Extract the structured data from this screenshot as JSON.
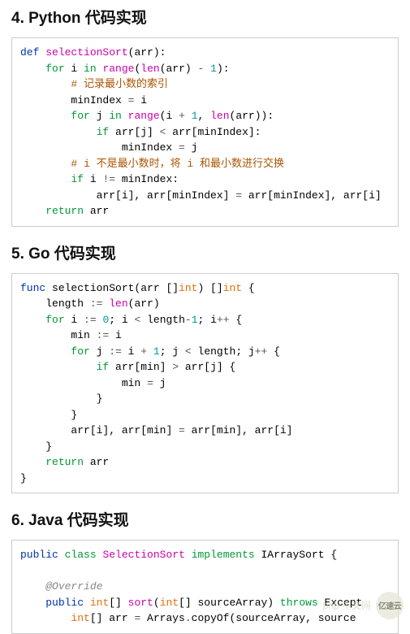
{
  "sections": {
    "python": {
      "heading": "4. Python 代码实现",
      "code": {
        "l1": {
          "kw": "def ",
          "fn": "selectionSort",
          "rest": "(arr):"
        },
        "l2": {
          "pre": "    ",
          "kw": "for",
          "rest1": " i ",
          "kw2": "in",
          "rest2": " ",
          "fn": "range",
          "rest3": "(",
          "fn2": "len",
          "rest4": "(arr) ",
          "op": "-",
          "rest5": " ",
          "num": "1",
          "rest6": "):"
        },
        "l3": {
          "pre": "        ",
          "c": "# 记录最小数的索引"
        },
        "l4": {
          "pre": "        ",
          "rest1": "minIndex ",
          "op": "=",
          "rest2": " i"
        },
        "l5": {
          "pre": "        ",
          "kw": "for",
          "rest1": " j ",
          "kw2": "in",
          "rest2": " ",
          "fn": "range",
          "rest3": "(i ",
          "op": "+",
          "rest4": " ",
          "num": "1",
          "rest5": ", ",
          "fn2": "len",
          "rest6": "(arr)):"
        },
        "l6": {
          "pre": "            ",
          "kw": "if",
          "rest1": " arr[j] ",
          "op": "<",
          "rest2": " arr[minIndex]:"
        },
        "l7": {
          "pre": "                ",
          "rest1": "minIndex ",
          "op": "=",
          "rest2": " j"
        },
        "l8": {
          "pre": "        ",
          "c": "# i 不是最小数时，将 i 和最小数进行交换"
        },
        "l9": {
          "pre": "        ",
          "kw": "if",
          "rest1": " i ",
          "op": "!=",
          "rest2": " minIndex:"
        },
        "l10": {
          "pre": "            ",
          "rest1": "arr[i], arr[minIndex] ",
          "op": "=",
          "rest2": " arr[minIndex], arr[i]"
        },
        "l11": {
          "pre": "    ",
          "kw": "return",
          "rest": " arr"
        }
      }
    },
    "go": {
      "heading": "5. Go 代码实现",
      "code": {
        "l1": {
          "kw": "func",
          "rest1": " selectionSort(arr []",
          "tp": "int",
          "rest2": ") []",
          "tp2": "int",
          "rest3": " {"
        },
        "l2": {
          "pre": "    ",
          "rest1": "length ",
          "op": ":=",
          "rest2": " ",
          "fn": "len",
          "rest3": "(arr)"
        },
        "l3": {
          "pre": "    ",
          "kw": "for",
          "rest1": " i ",
          "op": ":=",
          "rest2": " ",
          "num": "0",
          "rest3": "; i ",
          "op2": "<",
          "rest4": " length",
          "op3": "-",
          "num2": "1",
          "rest5": "; i",
          "op4": "++",
          "rest6": " {"
        },
        "l4": {
          "pre": "        ",
          "rest1": "min ",
          "op": ":=",
          "rest2": " i"
        },
        "l5": {
          "pre": "        ",
          "kw": "for",
          "rest1": " j ",
          "op": ":=",
          "rest2": " i ",
          "op2": "+",
          "rest3": " ",
          "num": "1",
          "rest4": "; j ",
          "op3": "<",
          "rest5": " length; j",
          "op4": "++",
          "rest6": " {"
        },
        "l6": {
          "pre": "            ",
          "kw": "if",
          "rest1": " arr[min] ",
          "op": ">",
          "rest2": " arr[j] {"
        },
        "l7": {
          "pre": "                ",
          "rest1": "min ",
          "op": "=",
          "rest2": " j"
        },
        "l8": {
          "pre": "            ",
          "rest": "}"
        },
        "l9": {
          "pre": "        ",
          "rest": "}"
        },
        "l10": {
          "pre": "        ",
          "rest1": "arr[i], arr[min] ",
          "op": "=",
          "rest2": " arr[min], arr[i]"
        },
        "l11": {
          "pre": "    ",
          "rest": "}"
        },
        "l12": {
          "pre": "    ",
          "kw": "return",
          "rest": " arr"
        },
        "l13": {
          "rest": "}"
        }
      }
    },
    "java": {
      "heading": "6. Java 代码实现",
      "code": {
        "l1": {
          "kw1": "public",
          "rest1": " ",
          "kw2": "class",
          "rest2": " ",
          "cls": "SelectionSort",
          "rest3": " ",
          "kw3": "implements",
          "rest4": " IArraySort {"
        },
        "l2": "",
        "l3": {
          "pre": "    ",
          "anno": "@Override"
        },
        "l4": {
          "pre": "    ",
          "kw1": "public",
          "rest1": " ",
          "tp": "int",
          "rest2": "[] ",
          "fn": "sort",
          "rest3": "(",
          "tp2": "int",
          "rest4": "[] sourceArray) ",
          "kw2": "throws",
          "rest5": " Except"
        },
        "l5": {
          "pre": "        ",
          "tp": "int",
          "rest1": "[] arr ",
          "op": "=",
          "rest2": " Arrays",
          "op2": ".",
          "rest3": "copyOf(sourceArray, source"
        }
      }
    }
  },
  "watermark": {
    "left": "php 中文网",
    "circle": "亿速云"
  }
}
